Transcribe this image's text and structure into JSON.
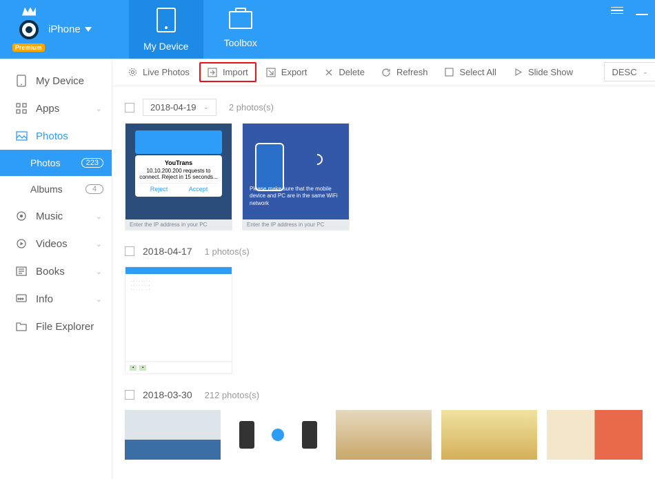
{
  "header": {
    "device_label": "iPhone",
    "premium": "Premium",
    "tabs": {
      "my_device": "My Device",
      "toolbox": "Toolbox"
    }
  },
  "sidebar": {
    "my_device": "My Device",
    "apps": "Apps",
    "photos": "Photos",
    "photos_sub": "Photos",
    "photos_count": "223",
    "albums": "Albums",
    "albums_count": "4",
    "music": "Music",
    "videos": "Videos",
    "books": "Books",
    "info": "Info",
    "file_explorer": "File Explorer"
  },
  "toolbar": {
    "live_photos": "Live Photos",
    "import": "Import",
    "export": "Export",
    "delete": "Delete",
    "refresh": "Refresh",
    "select_all": "Select All",
    "slide_show": "Slide Show",
    "sort": "DESC"
  },
  "sections": [
    {
      "date": "2018-04-19",
      "count": "2 photos(s)",
      "dropdown": true
    },
    {
      "date": "2018-04-17",
      "count": "1 photos(s)",
      "dropdown": false
    },
    {
      "date": "2018-03-30",
      "count": "212 photos(s)",
      "dropdown": false
    }
  ],
  "thumb_text": {
    "youtrans_title": "YouTrans",
    "youtrans_body": "10.10.200.200 requests to connect. Reject in 15 seconds...",
    "reject": "Reject",
    "accept": "Accept",
    "ip_hint": "Enter the IP address in your PC",
    "t2_msg": "Please make sure that the mobile device and PC are in the same WiFi network"
  }
}
